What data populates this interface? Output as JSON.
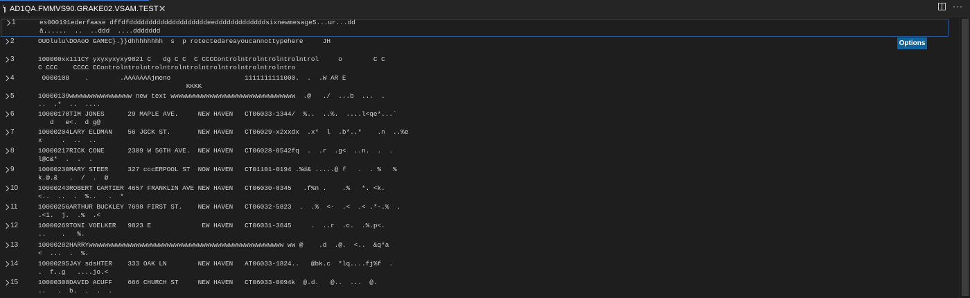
{
  "tab": {
    "label": "AD1QA.FMMVS90.GRAKE02.VSAM.TEST",
    "close": "✕"
  },
  "actions": {
    "more": "···"
  },
  "options_label": "Options",
  "records": [
    {
      "num": "1",
      "line1": "es000191ederfaase dffdfddddddddddddddddddddeedddddddddddddsixnewmesage5...ur...dd",
      "line2": "ā......  ..  ..ddd  ....ddddddd",
      "selected": true
    },
    {
      "num": "2",
      "line1": "OUOlulu\\DOAoO GAMEC}.}}dhhhhhhhh  s  p rotectedareayoucannottypehere     JH",
      "line2": ""
    },
    {
      "num": "3",
      "line1": "100000xx111CY yxyxyxyxy9821 C   dg C C  C CCCControlntrolntrolntrolntrol     o        C C",
      "line2": "C CCC    CCCC CControlntrolntrolntrolntrolntrolntrolntrolntrolntro"
    },
    {
      "num": "4",
      "line1": " 0000100    .        .AAAAAAAjmeno                   1111111111000.  .  .W AR E",
      "line2": "                                      KKKK"
    },
    {
      "num": "5",
      "line1": "10000139wwwwwwwwwwwwwwww new text wwwwwwwwwwwwwwwwwwwwwwwwwwwwwwww  .@   ./  ...b  ...  .",
      "line2": "..  .*  ..  ...."
    },
    {
      "num": "6",
      "line1": "10000178TIM JONES      29 MAPLE AVE.     NEW HAVEN   CT06033-1344/  %..  ..%.  ....l<qe*...`",
      "line2": "   d   e<.  d g@"
    },
    {
      "num": "7",
      "line1": "10000204LARY ELDMAN    56 JGCK ST.       NEW HAVEN   CT06029-x2xxdx  .x*  l  .b*..*    .n  ..%e",
      "line2": "x     .  ..  .."
    },
    {
      "num": "8",
      "line1": "10000217RICK CONE      2309 W 56TH AVE.  NEW HAVEN   CT06028-0542fq  .  .r  .g<  ..n.  .  .",
      "line2": "l@c&*  .  .  ."
    },
    {
      "num": "9",
      "line1": "10000230MARY STEER     327 cccERPOOL ST  NOW HAVEN   CT01101-0194 .%d& .....@ f   .  . %   %",
      "line2": "k.@.&   .  /  .  @"
    },
    {
      "num": "10",
      "line1": "10000243ROBERT CARTIER 4657 FRANKLIN AVE NEW HAVEN   CT06030-8345   .f%n .    .%   *. <k.",
      "line2": "<..  ..  .  %..   .  *"
    },
    {
      "num": "11",
      "line1": "10000256ARTHUR BUCKLEY 7698 FIRST ST.    NEW HAVEN   CT06032-5823  .  .%  <-  .<  .< .*-.%  .",
      "line2": ".<i.  j.  .%  .<"
    },
    {
      "num": "12",
      "line1": "10000269TONI VOELKER   9823 E             EW HAVEN   CT06031-3645     .  ..r  .c.  .%.p<.",
      "line2": "..    .   %."
    },
    {
      "num": "13",
      "line1": "10000282HARRYwwwwwwwwwwwwwwwwwwwwwwwwwwwwwwwwwwwwwwwwwwwwwwwwww ww @    .d  .@.  <..  &q*a",
      "line2": "<  ...  .  %."
    },
    {
      "num": "14",
      "line1": "10000295JAY sdsHTER    333 OAK LN        NEW HAVEN   AT06033-1824..   @bk.c  *lq....fj%f  .",
      "line2": ".  f..g   ....jo.<"
    },
    {
      "num": "15",
      "line1": "10000308DAVID ACUFF    666 CHURCH ST     NEW HAVEN   CT06033-0094k  @.d.   @..  ...  @.",
      "line2": "..   .  b.  .  .  ."
    }
  ]
}
